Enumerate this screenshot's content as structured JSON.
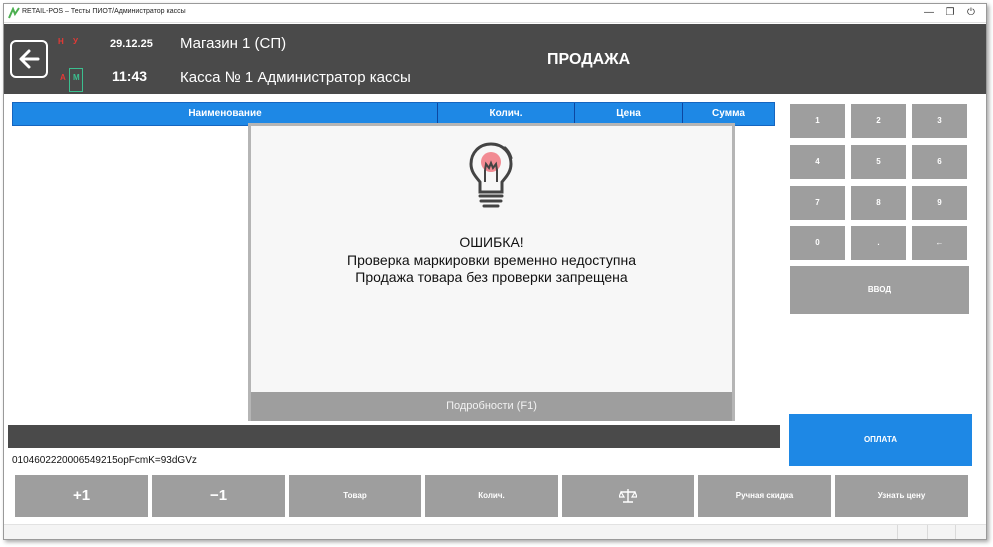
{
  "window": {
    "title": "RETAIL-POS – Тесты ПИОТ/Администратор кассы",
    "minimize_glyph": "—",
    "restore_glyph": "❐",
    "exit_glyph": "⏻"
  },
  "header": {
    "indicators": {
      "top_left": "Н",
      "top_right": "У",
      "bottom_left": "А",
      "bottom_right": "М"
    },
    "date": "29.12.25",
    "time": "11:43",
    "store": "Магазин 1 (СП)",
    "register": "Касса № 1 Администратор кассы",
    "operation": "ПРОДАЖА"
  },
  "table": {
    "columns": [
      "Наименование",
      "Колич.",
      "Цена",
      "Сумма"
    ]
  },
  "barcode": "0104602220006549215opFcmK=93dGVz",
  "keypad": {
    "keys": [
      "1",
      "2",
      "3",
      "4",
      "5",
      "6",
      "7",
      "8",
      "9",
      "0",
      ".",
      "←"
    ],
    "enter": "ВВОД"
  },
  "pay_button": "ОПЛАТА",
  "bottom_buttons": [
    "+1",
    "−1",
    "Товар",
    "Колич.",
    "scales-icon",
    "Ручная скидка",
    "Узнать цену"
  ],
  "modal": {
    "title": "ОШИБКА!",
    "line1": "Проверка маркировки временно недоступна",
    "line2": "Продажа товара без проверки запрещена",
    "details_button": "Подробности (F1)"
  },
  "colors": {
    "header_bg": "#4a4a4a",
    "accent_blue": "#1e88e5",
    "button_gray": "#9e9e9e",
    "indicator_red": "#e53935",
    "indicator_green": "#3bbf8f",
    "bulb_pink": "#f28b93"
  }
}
